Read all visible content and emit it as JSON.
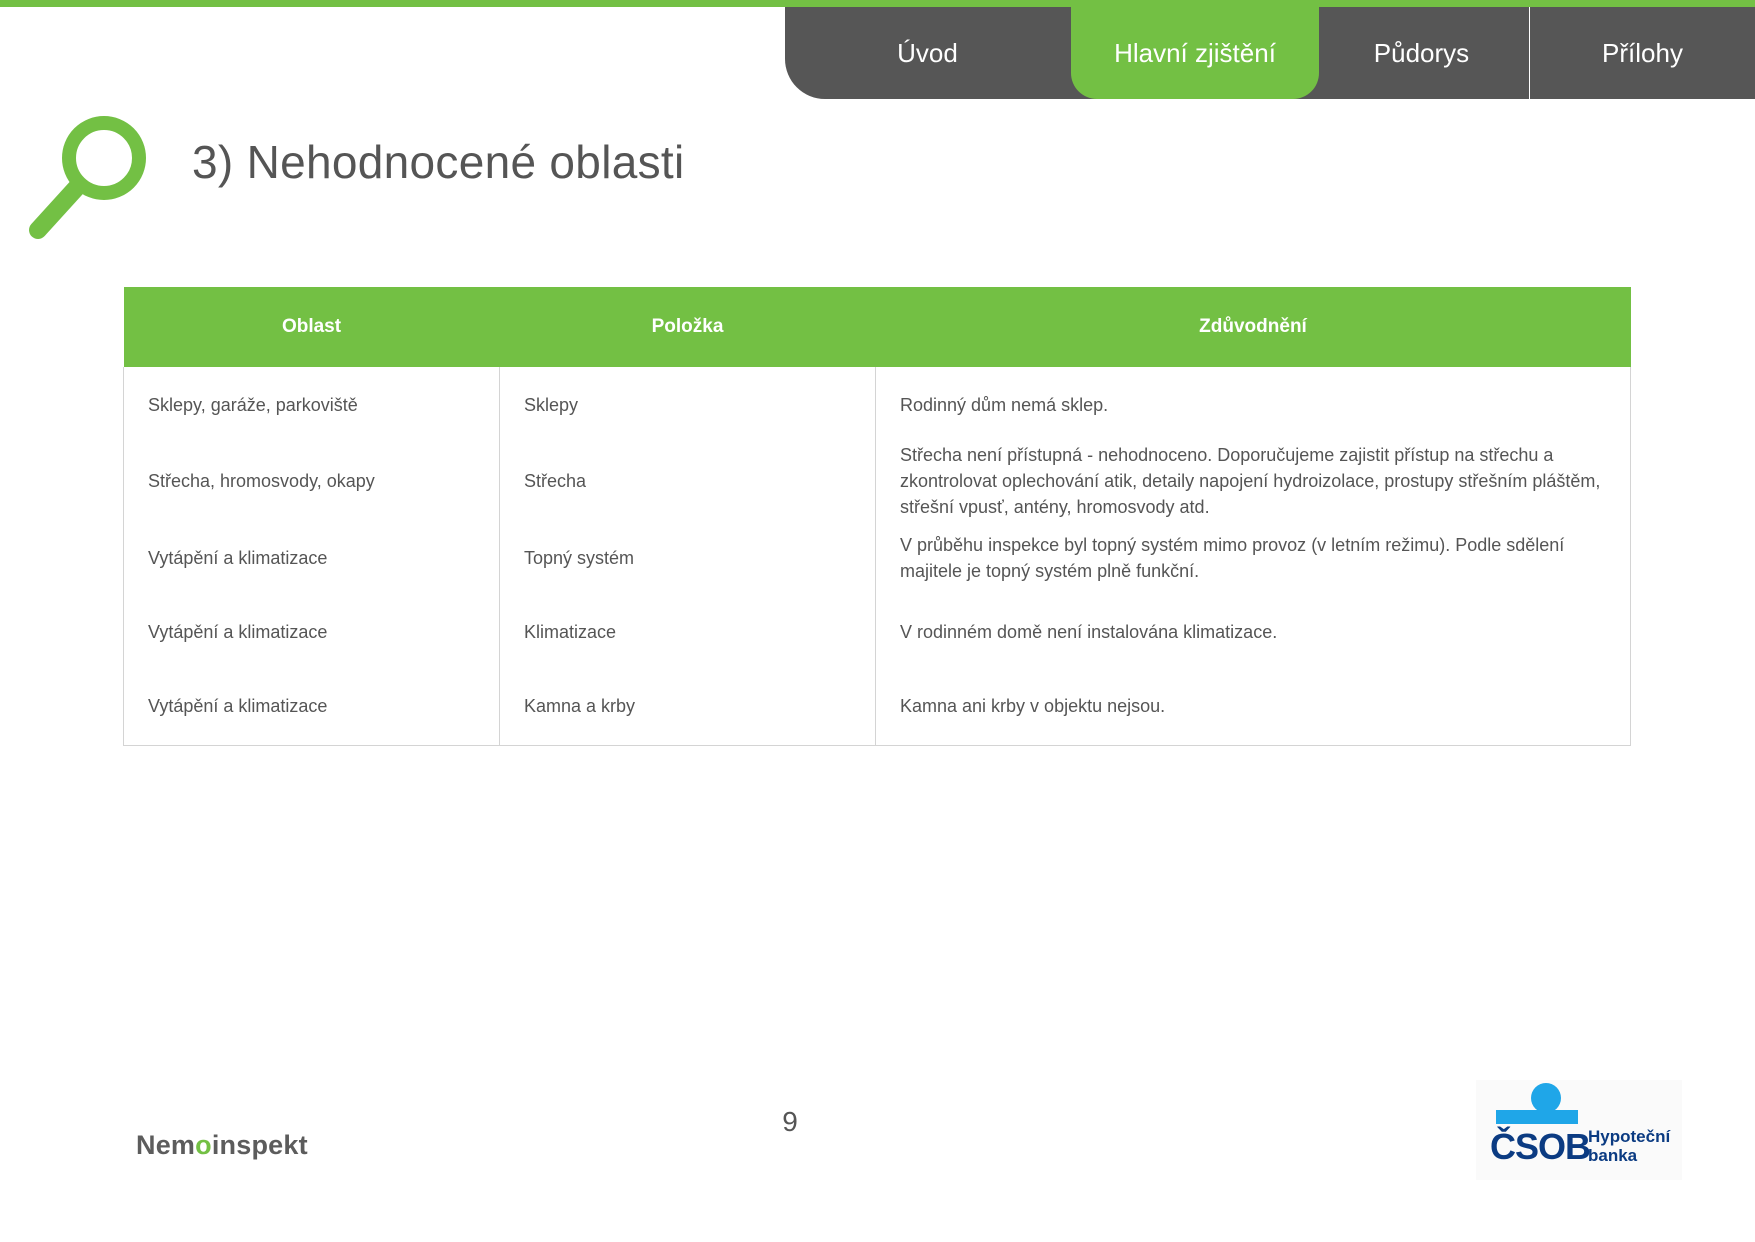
{
  "nav": {
    "tabs": [
      {
        "label": "Úvod",
        "active": false
      },
      {
        "label": "Hlavní zjištění",
        "active": true
      },
      {
        "label": "Půdorys",
        "active": false
      },
      {
        "label": "Přílohy",
        "active": false
      }
    ]
  },
  "page": {
    "title": "3) Nehodnocené oblasti",
    "number": "9"
  },
  "table": {
    "headers": [
      "Oblast",
      "Položka",
      "Zdůvodnění"
    ],
    "rows": [
      [
        "Sklepy, garáže, parkoviště",
        "Sklepy",
        "Rodinný dům nemá sklep."
      ],
      [
        "Střecha, hromosvody, okapy",
        "Střecha",
        "Střecha není přístupná - nehodnoceno. Doporučujeme zajistit přístup na střechu a zkontrolovat oplechování atik, detaily napojení hydroizolace, prostupy střešním pláštěm, střešní vpusť, antény, hromosvody atd."
      ],
      [
        "Vytápění a klimatizace",
        "Topný systém",
        "V průběhu inspekce byl topný systém mimo provoz (v letním režimu). Podle sdělení majitele je topný systém plně funkční."
      ],
      [
        "Vytápění a klimatizace",
        "Klimatizace",
        "V rodinném domě není instalována klimatizace."
      ],
      [
        "Vytápění a klimatizace",
        "Kamna a krby",
        "Kamna ani krby v objektu nejsou."
      ]
    ]
  },
  "footer": {
    "left_logo": {
      "part1": "Nem",
      "accent": "o",
      "part2": "inspekt"
    },
    "right_logo": {
      "word": "ČSOB",
      "line1": "Hypoteční",
      "line2": "banka"
    }
  },
  "colors": {
    "accent": "#73c044",
    "nav_bg": "#565656",
    "text": "#555555",
    "brand_blue": "#0b3b82",
    "brand_light_blue": "#1fa6e8"
  },
  "icons": [
    "search-icon"
  ]
}
